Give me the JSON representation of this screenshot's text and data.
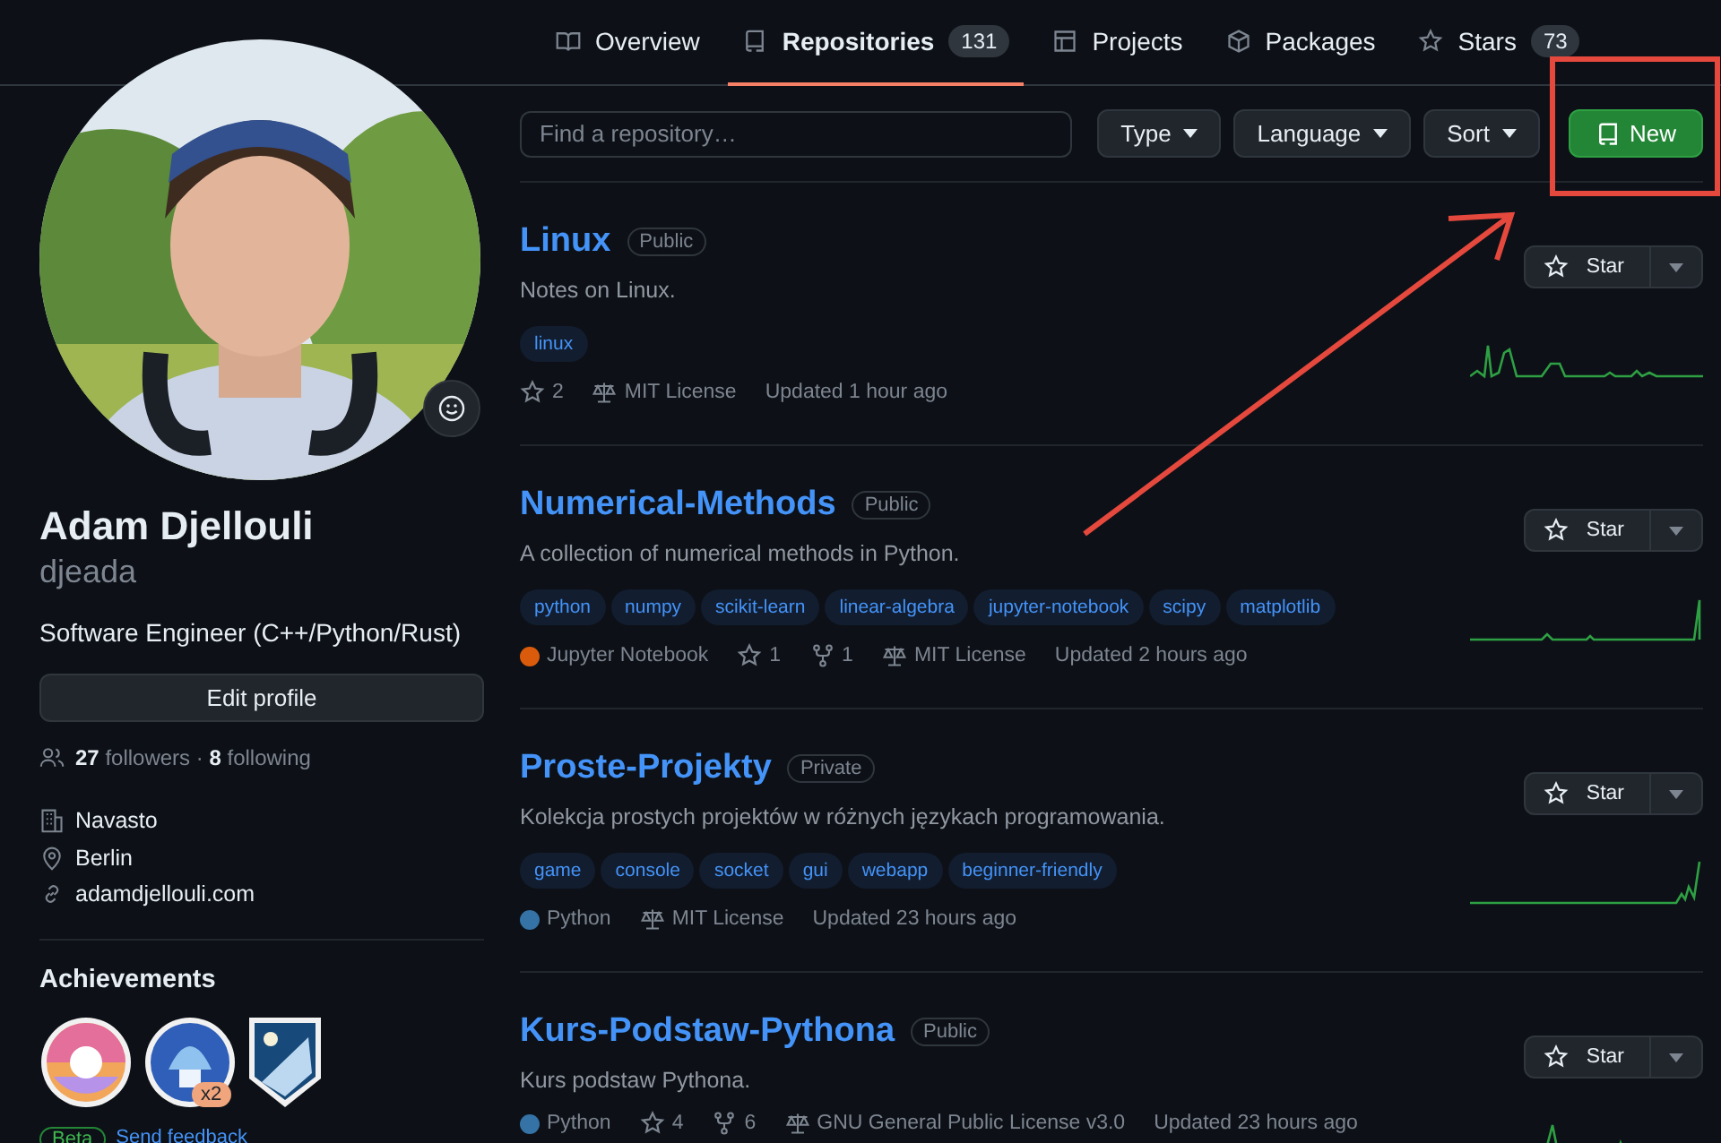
{
  "tabs": [
    {
      "label": "Overview",
      "kind": "book",
      "selected": false
    },
    {
      "label": "Repositories",
      "kind": "repo",
      "count": "131",
      "selected": true
    },
    {
      "label": "Projects",
      "kind": "table",
      "selected": false
    },
    {
      "label": "Packages",
      "kind": "package",
      "selected": false
    },
    {
      "label": "Stars",
      "kind": "star",
      "count": "73",
      "selected": false
    }
  ],
  "profile": {
    "name": "Adam Djellouli",
    "username": "djeada",
    "bio": "Software Engineer (C++/Python/Rust)",
    "edit_button": "Edit profile",
    "follow": "**27** followers · **8** following",
    "details": [
      {
        "kind": "org",
        "text": "Navasto"
      },
      {
        "kind": "location",
        "text": "Berlin"
      },
      {
        "kind": "link",
        "text": "adamdjellouli.com"
      }
    ],
    "achievements_title": "Achievements",
    "achievement_count": "x2",
    "beta": "Beta",
    "feedback": "Send feedback"
  },
  "search": {
    "placeholder": "Find a repository…"
  },
  "filters": [
    "Type",
    "Language",
    "Sort"
  ],
  "new_button": "New",
  "repos": [
    {
      "name": "Linux",
      "visibility": "Public",
      "description": "Notes on Linux.",
      "topics": [
        "linux"
      ],
      "star_button": "Star",
      "meta": [
        {
          "kind": "stars",
          "text": "2"
        },
        {
          "kind": "license",
          "text": "MIT License"
        },
        {
          "kind": "updated",
          "text": "Updated 1 hour ago"
        }
      ]
    },
    {
      "name": "Numerical-Methods",
      "visibility": "Public",
      "description": "A collection of numerical methods in Python.",
      "topics": [
        "python",
        "numpy",
        "scikit-learn",
        "linear-algebra",
        "jupyter-notebook",
        "scipy",
        "matplotlib"
      ],
      "star_button": "Star",
      "meta": [
        {
          "kind": "language",
          "text": "Jupyter Notebook",
          "color": "#da5b0b"
        },
        {
          "kind": "stars",
          "text": "1"
        },
        {
          "kind": "forks",
          "text": "1"
        },
        {
          "kind": "license",
          "text": "MIT License"
        },
        {
          "kind": "updated",
          "text": "Updated 2 hours ago"
        }
      ]
    },
    {
      "name": "Proste-Projekty",
      "visibility": "Private",
      "description": "Kolekcja prostych projektów w różnych językach programowania.",
      "topics": [
        "game",
        "console",
        "socket",
        "gui",
        "webapp",
        "beginner-friendly"
      ],
      "star_button": "Star",
      "meta": [
        {
          "kind": "language",
          "text": "Python",
          "color": "#3572a5"
        },
        {
          "kind": "license",
          "text": "MIT License"
        },
        {
          "kind": "updated",
          "text": "Updated 23 hours ago"
        }
      ]
    },
    {
      "name": "Kurs-Podstaw-Pythona",
      "visibility": "Public",
      "description": "Kurs podstaw Pythona.",
      "star_button": "Star",
      "meta": [
        {
          "kind": "language",
          "text": "Python",
          "color": "#3572a5"
        },
        {
          "kind": "stars",
          "text": "4"
        },
        {
          "kind": "forks",
          "text": "6"
        },
        {
          "kind": "license",
          "text": "GNU General Public License v3.0"
        },
        {
          "kind": "updated",
          "text": "Updated 23 hours ago"
        }
      ]
    }
  ]
}
